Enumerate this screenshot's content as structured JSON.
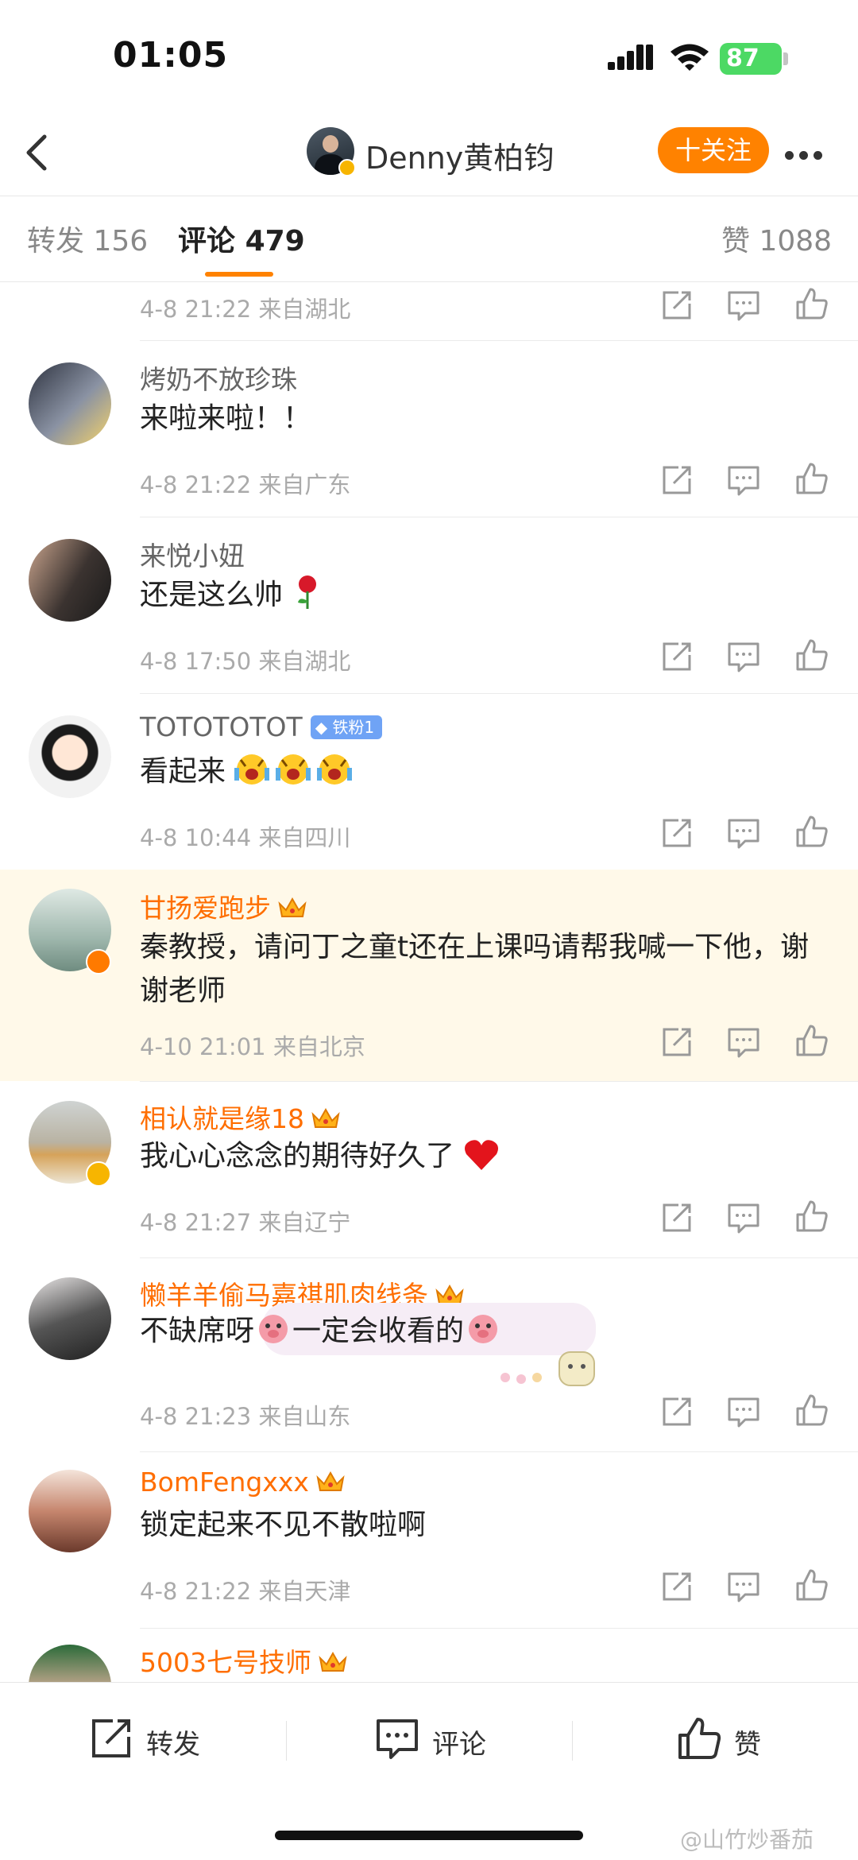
{
  "status_bar": {
    "time": "01:05",
    "battery": "87"
  },
  "nav": {
    "title": "Denny黄柏钧",
    "follow_label": "十关注"
  },
  "tabs": [
    {
      "label": "转发",
      "count": "156"
    },
    {
      "label": "评论",
      "count": "479"
    },
    {
      "label": "赞",
      "count": "1088"
    }
  ],
  "comments": [
    {
      "meta": "4-8 21:22  来自湖北"
    },
    {
      "name": "烤奶不放珍珠",
      "text": "来啦来啦！！",
      "meta": "4-8 21:22  来自广东"
    },
    {
      "name": "来悦小妞",
      "text": "还是这么帅",
      "meta": "4-8 17:50  来自湖北"
    },
    {
      "name": "TOTOTOTOT",
      "badge": "铁粉1",
      "text": "看起来",
      "meta": "4-8 10:44  来自四川"
    },
    {
      "name": "甘扬爱跑步",
      "text": "秦教授，请问丁之童t还在上课吗请帮我喊一下他，谢谢老师",
      "meta": "4-10 21:01  来自北京"
    },
    {
      "name": "相认就是缘18",
      "text": "我心心念念的期待好久了",
      "meta": "4-8 21:27  来自辽宁"
    },
    {
      "name": "懒羊羊偷马嘉祺肌肉线条",
      "text_a": "不缺席呀",
      "text_b": "一定会收看的",
      "meta": "4-8 21:23  来自山东"
    },
    {
      "name": "BomFengxxx",
      "text": "锁定起来不见不散啦啊",
      "meta": "4-8 21:22  来自天津"
    },
    {
      "name": "5003七号技师"
    }
  ],
  "bottom_bar": {
    "repost": "转发",
    "comment": "评论",
    "like": "赞"
  },
  "watermark": "@山竹炒番茄",
  "colors": {
    "accent": "#ff8200",
    "vip_name": "#ff6e00",
    "highlight_bg": "#fff9e9",
    "fan_badge": "#6fa3f5"
  }
}
